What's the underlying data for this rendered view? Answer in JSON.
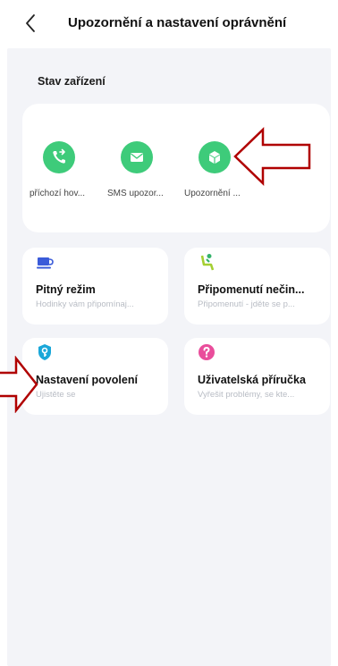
{
  "header": {
    "back_icon": "chevron-left-icon",
    "title": "Upozornění a nastavení oprávnění"
  },
  "device_status": {
    "section_title": "Stav zařízení",
    "items": [
      {
        "icon": "phone-incoming-icon",
        "label": "příchozí hov..."
      },
      {
        "icon": "message-icon",
        "label": "SMS upozor..."
      },
      {
        "icon": "cube-icon",
        "label": "Upozornění ..."
      }
    ]
  },
  "features": [
    {
      "icon": "cup-icon",
      "name": "Pitný režim",
      "desc": "Hodinky vám připomínaj..."
    },
    {
      "icon": "chair-person-icon",
      "name": "Připomenutí nečin...",
      "desc": "Připomenutí - jděte se p..."
    },
    {
      "icon": "shield-key-icon",
      "name": "Nastavení povolení",
      "desc": "Ujistěte se"
    },
    {
      "icon": "question-icon",
      "name": "Uživatelská příručka",
      "desc": "Vyřešit problémy, se kte..."
    }
  ],
  "annotations": {
    "arrow_color": "#b00000",
    "accent_green": "#3ecb7a"
  }
}
